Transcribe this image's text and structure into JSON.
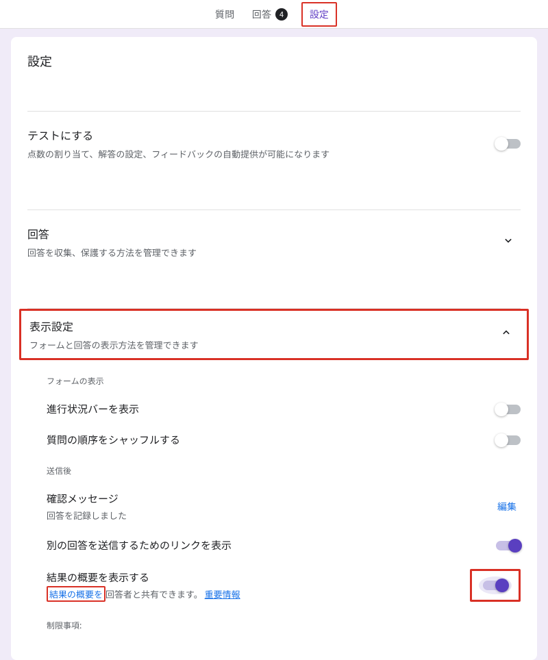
{
  "tabs": {
    "questions": "質問",
    "responses": "回答",
    "responses_count": "4",
    "settings": "設定"
  },
  "page": {
    "title": "設定"
  },
  "sections": {
    "quiz": {
      "title": "テストにする",
      "desc": "点数の割り当て、解答の設定、フィードバックの自動提供が可能になります"
    },
    "responses": {
      "title": "回答",
      "desc": "回答を収集、保護する方法を管理できます"
    },
    "presentation": {
      "title": "表示設定",
      "desc": "フォームと回答の表示方法を管理できます"
    }
  },
  "presentation": {
    "form_display_label": "フォームの表示",
    "progress_bar": "進行状況バーを表示",
    "shuffle": "質問の順序をシャッフルする",
    "after_submit_label": "送信後",
    "confirm_title": "確認メッセージ",
    "confirm_value": "回答を記録しました",
    "edit": "編集",
    "submit_another": "別の回答を送信するためのリンクを表示",
    "show_summary": "結果の概要を表示する",
    "summary_link": "結果の概要を",
    "summary_rest": "回答者と共有できます。",
    "important": "重要情報",
    "restrictions_label": "制限事項:"
  }
}
